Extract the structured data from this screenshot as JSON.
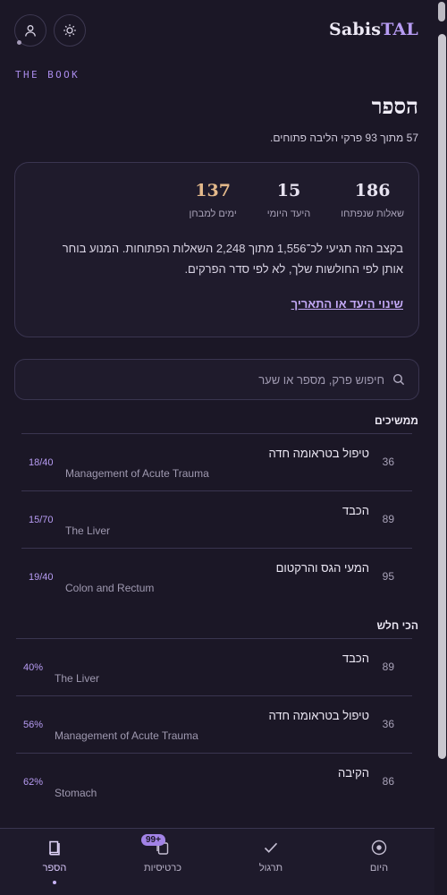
{
  "brand": {
    "name_part1": "Sabis",
    "name_part2": "TAL"
  },
  "header": {
    "eyebrow": "THE BOOK",
    "title": "הספר",
    "subtitle": "57 מתוך 93 פרקי הליבה פתוחים."
  },
  "stats": [
    {
      "value": "137",
      "label": "ימים למבחן"
    },
    {
      "value": "15",
      "label": "היעד היומי"
    },
    {
      "value": "186",
      "label": "שאלות שנפתחו"
    }
  ],
  "card": {
    "text": "בקצב הזה תגיעי לכ־1,556 מתוך 2,248 השאלות הפתוחות. המנוע בוחר אותן לפי החולשות שלך, לא לפי סדר הפרקים.",
    "link": "שינוי היעד או התאריך"
  },
  "search": {
    "placeholder": "חיפוש פרק, מספר או שער"
  },
  "continuing": {
    "heading": "ממשיכים",
    "items": [
      {
        "num": "36",
        "he": "טיפול בטראומה חדה",
        "en": "Management of Acute Trauma",
        "progress": "18/40"
      },
      {
        "num": "89",
        "he": "הכבד",
        "en": "The Liver",
        "progress": "15/70"
      },
      {
        "num": "95",
        "he": "המעי הגס והרקטום",
        "en": "Colon and Rectum",
        "progress": "19/40"
      }
    ]
  },
  "weakest": {
    "heading": "הכי חלש",
    "items": [
      {
        "num": "89",
        "he": "הכבד",
        "en": "The Liver",
        "progress": "40%"
      },
      {
        "num": "36",
        "he": "טיפול בטראומה חדה",
        "en": "Management of Acute Trauma",
        "progress": "56%"
      },
      {
        "num": "86",
        "he": "הקיבה",
        "en": "Stomach",
        "progress": "62%"
      }
    ]
  },
  "nav": {
    "today": "היום",
    "practice": "תרגול",
    "cards": "כרטיסיות",
    "cards_badge": "99+",
    "book": "הספר"
  }
}
